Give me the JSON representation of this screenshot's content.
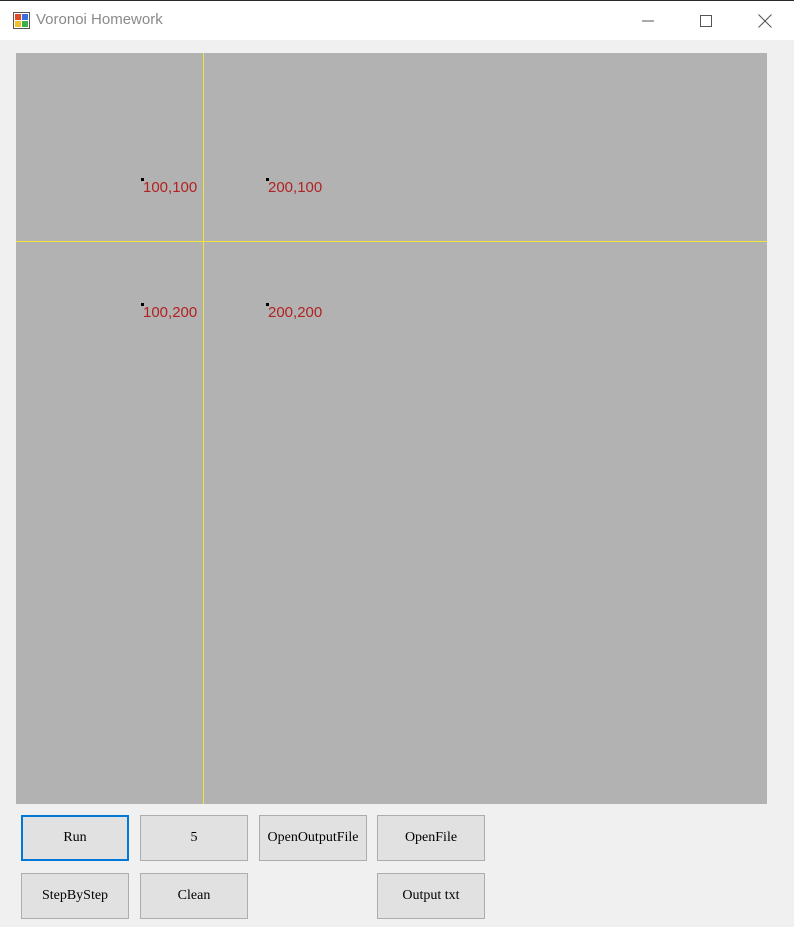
{
  "window": {
    "title": "Voronoi Homework"
  },
  "canvas": {
    "points": [
      {
        "label": "100,100"
      },
      {
        "label": "200,100"
      },
      {
        "label": "100,200"
      },
      {
        "label": "200,200"
      }
    ]
  },
  "buttons": {
    "run": "Run",
    "five": "5",
    "open_output_file": "OpenOutputFile",
    "open_file": "OpenFile",
    "step_by_step": "StepByStep",
    "clean": "Clean",
    "output_txt": "Output txt"
  },
  "colors": {
    "canvas_bg": "#b2b2b2",
    "line": "#f2e634",
    "label": "#b22222",
    "focus": "#0078d7"
  }
}
